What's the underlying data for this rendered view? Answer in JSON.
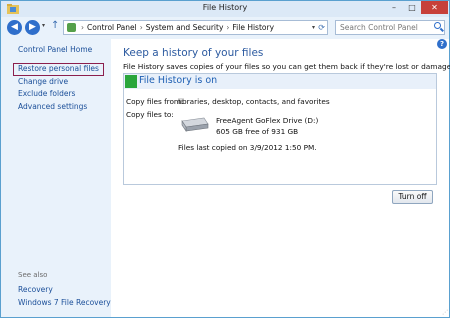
{
  "window": {
    "title": "File History",
    "min_glyph": "–",
    "max_glyph": "□",
    "close_glyph": "✕"
  },
  "nav": {
    "back_glyph": "◀",
    "forward_glyph": "▶",
    "recent_glyph": "▾",
    "up_glyph": "↑",
    "breadcrumb": [
      "Control Panel",
      "System and Security",
      "File History"
    ],
    "breadcrumb_sep": "›",
    "search_placeholder": "Search Control Panel"
  },
  "sidebar": {
    "home": "Control Panel Home",
    "items": [
      "Restore personal files",
      "Change drive",
      "Exclude folders",
      "Advanced settings"
    ],
    "see_also_label": "See also",
    "see_also": [
      "Recovery",
      "Windows 7 File Recovery"
    ]
  },
  "main": {
    "heading": "Keep a history of your files",
    "subtext": "File History saves copies of your files so you can get them back if they're lost or damaged.",
    "status": {
      "title": "File History is on",
      "copy_from_label": "Copy files from:",
      "copy_from_value": "libraries, desktop, contacts, and favorites",
      "copy_to_label": "Copy files to:",
      "drive_name": "FreeAgent GoFlex Drive (D:)",
      "drive_space": "605 GB free of 931 GB",
      "last_copied": "Files last copied on 3/9/2012 1:50 PM."
    },
    "turn_off_label": "Turn off",
    "help_glyph": "?"
  },
  "colors": {
    "accent": "#1e5fb3",
    "status_on": "#2aa63b",
    "selection_border": "#8c1f4d",
    "close": "#c7403a"
  }
}
